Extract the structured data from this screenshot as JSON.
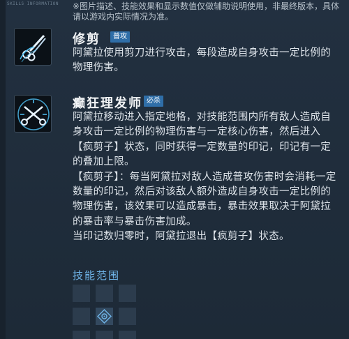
{
  "header": {
    "section_label": "SKILLS INFORMATION",
    "notice": "※图片描述、技能效果和显示数值仅做辅助说明使用，非最终版本，具体请以游戏内实际情况为准。"
  },
  "skills": [
    {
      "name": "修剪",
      "tag": "普攻",
      "icon": "scissors-icon",
      "description": [
        "阿黛拉使用剪刀进行攻击，每段造成自身攻击一定比例的物理伤害。"
      ]
    },
    {
      "name": "癫狂理发师",
      "tag": "必杀",
      "icon": "scissors-burst-icon",
      "description": [
        "阿黛拉移动进入指定地格，对技能范围内所有敌人造成自身攻击一定比例的物理伤害与一定核心伤害，然后进入【疯剪子】状态，同时获得一定数量的印记，印记有一定的叠加上限。",
        "【疯剪子】：每当阿黛拉对敌人造成普攻伤害时会消耗一定数量的印记，然后对该敌人额外造成自身攻击一定比例的物理伤害，该效果可以造成暴击，暴击效果取决于阿黛拉的暴击率与暴击伤害加成。",
        "当印记数归零时，阿黛拉退出【疯剪子】状态。"
      ]
    }
  ],
  "range": {
    "title": "技能范围",
    "center_icon": "target-icon"
  },
  "colors": {
    "tag_bg": "#2f6ea8",
    "range_title": "#6fb4e8",
    "icon_accent": "#4fc3f7"
  }
}
